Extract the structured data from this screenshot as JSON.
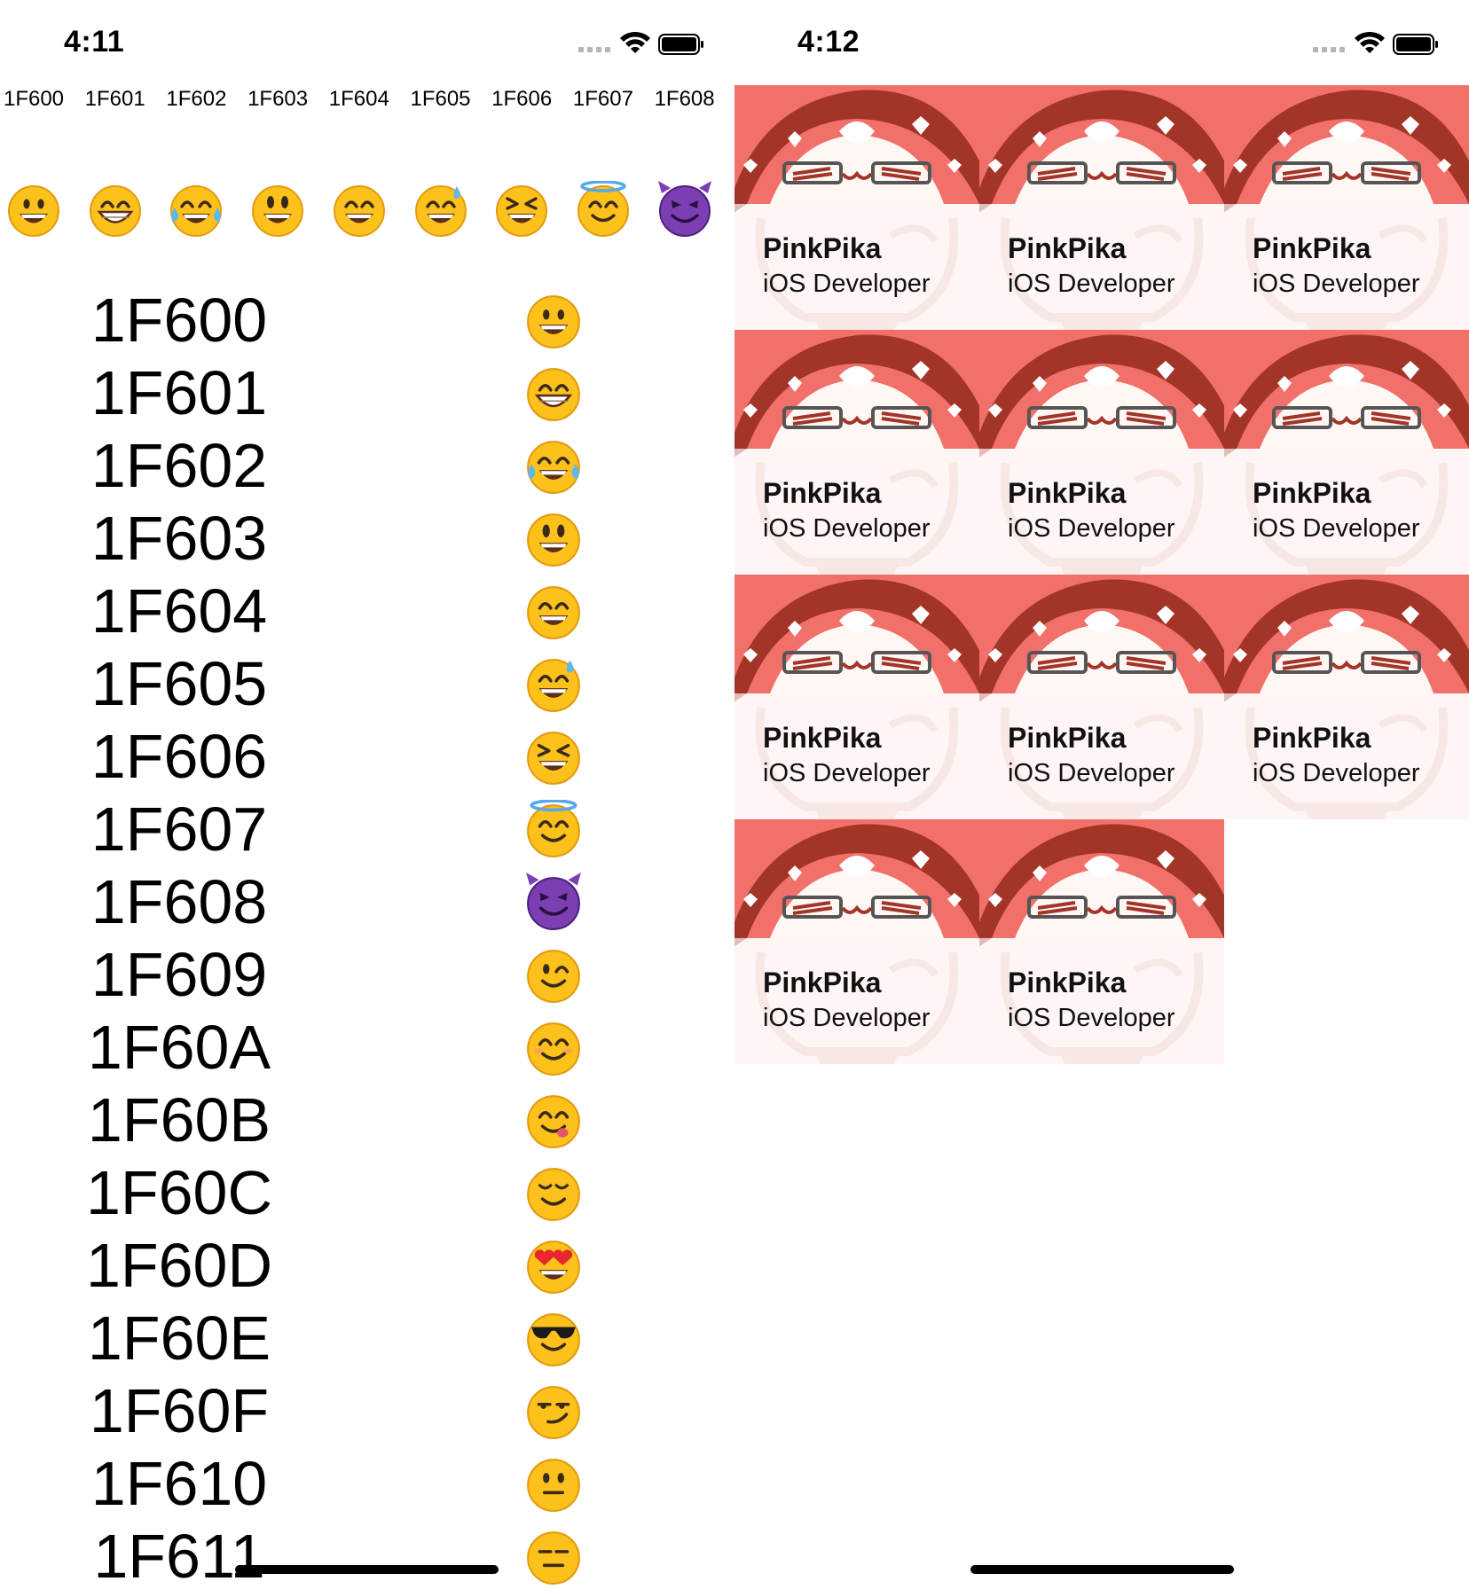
{
  "left_screen": {
    "status": {
      "time": "4:11"
    },
    "horizontal_row": [
      {
        "code": "1F600",
        "icon": "grinning-face"
      },
      {
        "code": "1F601",
        "icon": "beaming-face"
      },
      {
        "code": "1F602",
        "icon": "tears-of-joy-face"
      },
      {
        "code": "1F603",
        "icon": "grinning-big-eyes-face"
      },
      {
        "code": "1F604",
        "icon": "grinning-smiling-eyes-face"
      },
      {
        "code": "1F605",
        "icon": "grinning-sweat-face"
      },
      {
        "code": "1F606",
        "icon": "squinting-face"
      },
      {
        "code": "1F607",
        "icon": "halo-face"
      },
      {
        "code": "1F608",
        "icon": "smiling-devil-face"
      }
    ],
    "vertical_list": [
      {
        "code": "1F600",
        "icon": "grinning-face"
      },
      {
        "code": "1F601",
        "icon": "beaming-face"
      },
      {
        "code": "1F602",
        "icon": "tears-of-joy-face"
      },
      {
        "code": "1F603",
        "icon": "grinning-big-eyes-face"
      },
      {
        "code": "1F604",
        "icon": "grinning-smiling-eyes-face"
      },
      {
        "code": "1F605",
        "icon": "grinning-sweat-face"
      },
      {
        "code": "1F606",
        "icon": "squinting-face"
      },
      {
        "code": "1F607",
        "icon": "halo-face"
      },
      {
        "code": "1F608",
        "icon": "smiling-devil-face"
      },
      {
        "code": "1F609",
        "icon": "winking-face"
      },
      {
        "code": "1F60A",
        "icon": "smiling-blush-face"
      },
      {
        "code": "1F60B",
        "icon": "savoring-food-face"
      },
      {
        "code": "1F60C",
        "icon": "relieved-face"
      },
      {
        "code": "1F60D",
        "icon": "heart-eyes-face"
      },
      {
        "code": "1F60E",
        "icon": "sunglasses-face"
      },
      {
        "code": "1F60F",
        "icon": "smirking-face"
      },
      {
        "code": "1F610",
        "icon": "neutral-face"
      },
      {
        "code": "1F611",
        "icon": "expressionless-face"
      }
    ]
  },
  "right_screen": {
    "status": {
      "time": "4:12"
    },
    "cards": [
      {
        "name": "PinkPika",
        "role": "iOS Developer"
      },
      {
        "name": "PinkPika",
        "role": "iOS Developer"
      },
      {
        "name": "PinkPika",
        "role": "iOS Developer"
      },
      {
        "name": "PinkPika",
        "role": "iOS Developer"
      },
      {
        "name": "PinkPika",
        "role": "iOS Developer"
      },
      {
        "name": "PinkPika",
        "role": "iOS Developer"
      },
      {
        "name": "PinkPika",
        "role": "iOS Developer"
      },
      {
        "name": "PinkPika",
        "role": "iOS Developer"
      },
      {
        "name": "PinkPika",
        "role": "iOS Developer"
      },
      {
        "name": "PinkPika",
        "role": "iOS Developer"
      },
      {
        "name": "PinkPika",
        "role": "iOS Developer"
      }
    ]
  },
  "colors": {
    "emoji_yellow": "#fcc21b",
    "emoji_outline": "#e39a10",
    "devil_purple": "#7b3fb3",
    "card_red": "#f2706a",
    "card_dark": "#a23428",
    "card_pink": "#fbe1dc"
  }
}
